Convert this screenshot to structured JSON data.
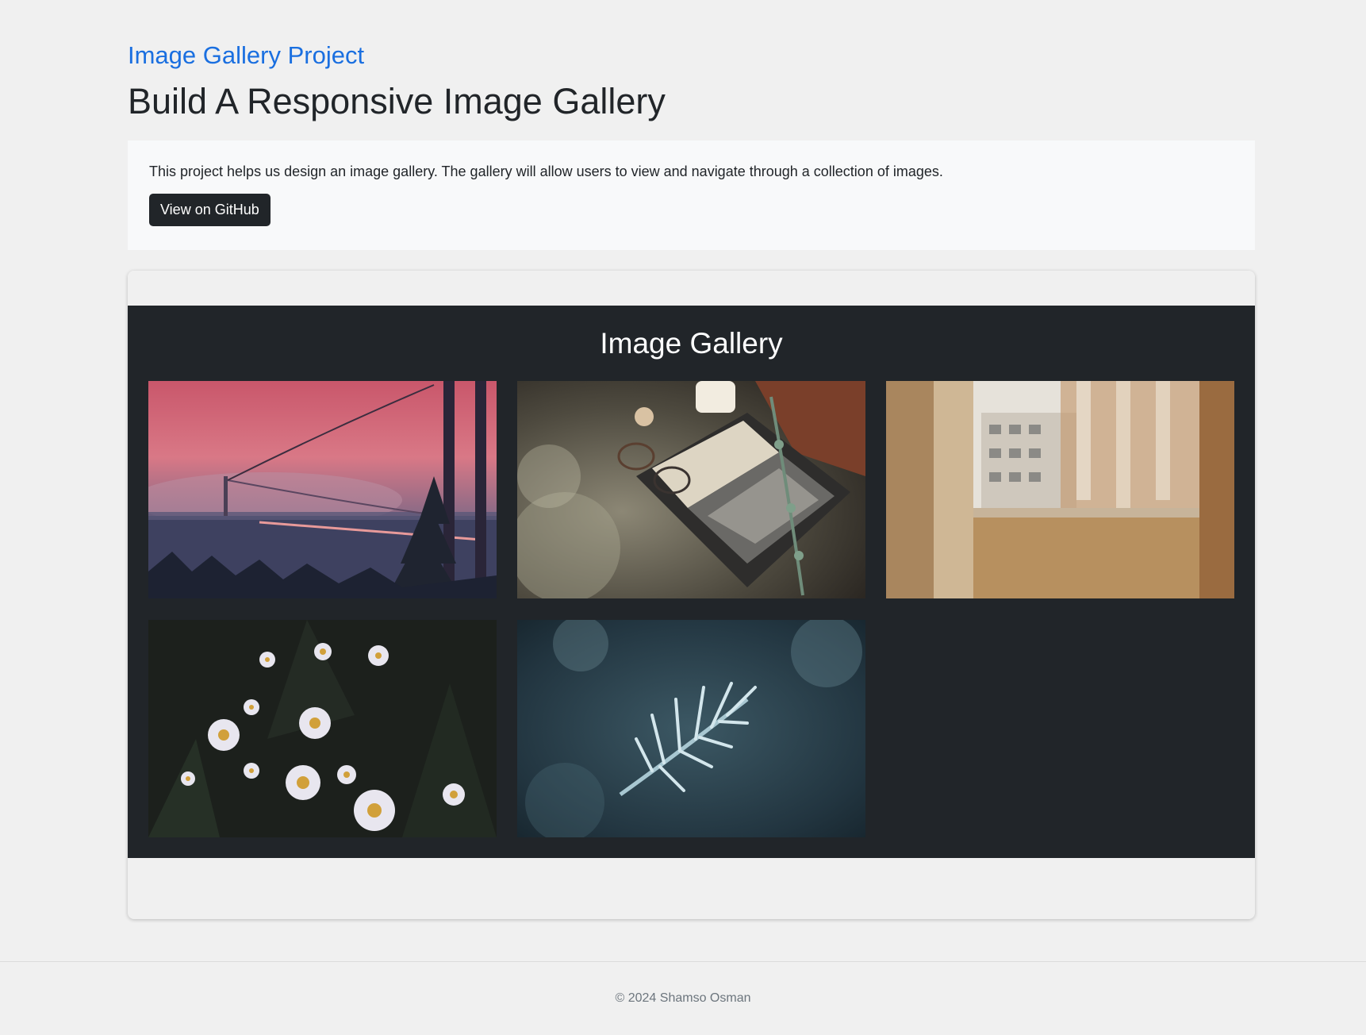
{
  "header": {
    "eyebrow": "Image Gallery Project",
    "title": "Build A Responsive Image Gallery"
  },
  "intro": {
    "description": "This project helps us design an image gallery. The gallery will allow users to view and navigate through a collection of images.",
    "github_button_label": "View on GitHub"
  },
  "gallery": {
    "title": "Image Gallery",
    "images": [
      {
        "subject": "suspension bridge at pink foggy sunset",
        "icon": "photo-bridge"
      },
      {
        "subject": "open book with glasses, candle and eucalyptus",
        "icon": "photo-book"
      },
      {
        "subject": "window with lace curtains and buildings",
        "icon": "photo-window"
      },
      {
        "subject": "white daisies in dark foliage",
        "icon": "photo-daisies"
      },
      {
        "subject": "frost-covered pine branch",
        "icon": "photo-frost"
      }
    ]
  },
  "footer": {
    "copyright": "© 2024 Shamso Osman"
  },
  "colors": {
    "accent": "#1a6fe0",
    "dark": "#212529",
    "page_bg": "#f0f0f0",
    "panel_bg": "#f8f9fa"
  }
}
